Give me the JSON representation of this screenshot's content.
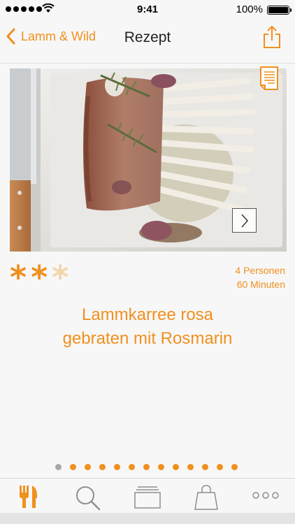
{
  "status_bar": {
    "time": "9:41",
    "battery_percent": "100%",
    "signal_bars": 5,
    "battery_level": 1.0
  },
  "nav": {
    "back_label": "Lamm & Wild",
    "title": "Rezept"
  },
  "recipe": {
    "rating_filled": 2,
    "rating_max": 3,
    "persons": "4 Personen",
    "duration": "60 Minuten",
    "title_line1": "Lammkarree rosa",
    "title_line2": "gebraten mit Rosmarin"
  },
  "pager": {
    "count": 13,
    "active_index": 0
  },
  "tabs": [
    {
      "name": "recipes",
      "icon": "fork-knife-icon"
    },
    {
      "name": "search",
      "icon": "search-icon"
    },
    {
      "name": "collections",
      "icon": "folder-stack-icon"
    },
    {
      "name": "shopping",
      "icon": "shopping-bag-icon"
    },
    {
      "name": "more",
      "icon": "more-icon"
    }
  ],
  "colors": {
    "accent": "#f0901e",
    "accent_light": "#f1d6ac",
    "background": "#f7f7f7"
  }
}
